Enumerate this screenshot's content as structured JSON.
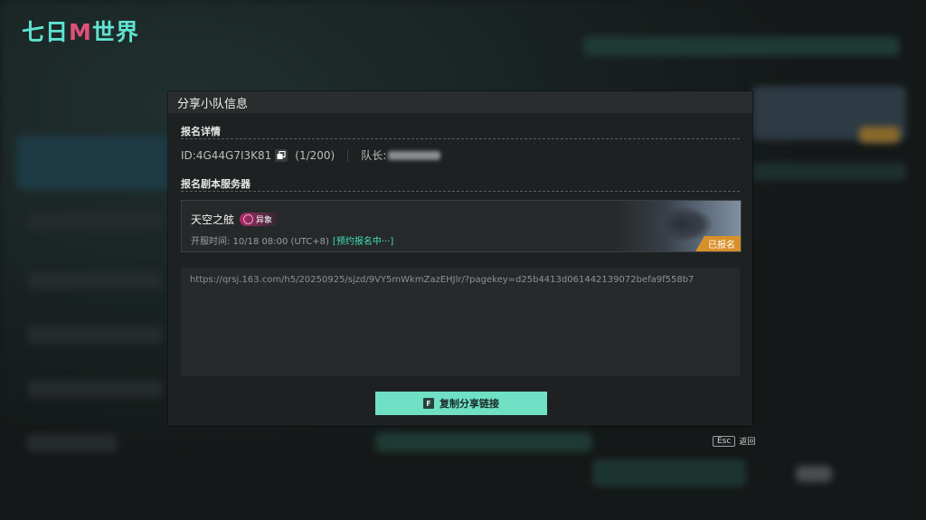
{
  "brand": {
    "logo_left": "七日",
    "logo_mid": "M",
    "logo_right": "世界"
  },
  "dialog": {
    "title": "分享小队信息",
    "section_signup": "报名详情",
    "team_id": "ID:4G44G7I3K81",
    "member_count": "(1/200)",
    "captain_label": "队长:",
    "section_server": "报名剧本服务器",
    "server_name": "天空之舷",
    "server_tag": "异象",
    "server_time_prefix": "开服时间: 10/18 08:00 (UTC+8)",
    "server_status": "[预约报名中···]",
    "signup_badge": "已报名",
    "share_link": "https://qrsj.163.com/h5/20250925/sjzd/9VY5mWkmZazEHJlr/?pagekey=d25b4413d061442139072befa9f558b7",
    "copy_key": "F",
    "copy_button": "复制分享链接"
  },
  "hint": {
    "esc_key": "Esc",
    "back_label": "返回"
  },
  "colors": {
    "accent": "#6fe0c4",
    "status": "#3fe0b8",
    "badge": "#d8902a",
    "tag": "#b02a6a"
  },
  "icons": {
    "copy": "copy-icon"
  }
}
